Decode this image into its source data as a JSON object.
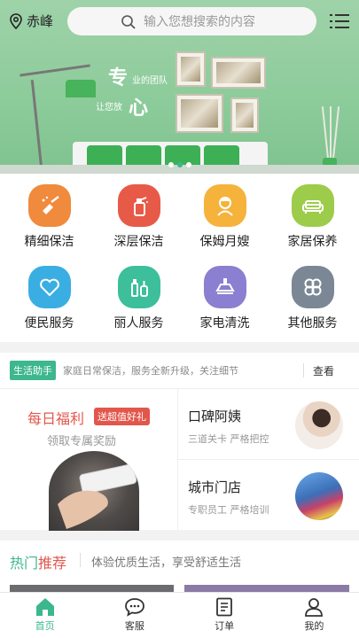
{
  "location": {
    "city": "赤峰"
  },
  "search": {
    "placeholder": "输入您想搜索的内容"
  },
  "banner": {
    "slogan_big_1": "专",
    "slogan_small_1": "业的团队",
    "slogan_small_2": "让您放",
    "slogan_big_2": "心",
    "slides": 3,
    "active_slide": 2
  },
  "services": [
    {
      "label": "精细保洁",
      "icon": "broom-icon",
      "color": "#f08a3c"
    },
    {
      "label": "深层保洁",
      "icon": "spray-bottle-icon",
      "color": "#e85a48"
    },
    {
      "label": "保姆月嫂",
      "icon": "nanny-icon",
      "color": "#f5b33c"
    },
    {
      "label": "家居保养",
      "icon": "sofa-icon",
      "color": "#9ccc4a"
    },
    {
      "label": "便民服务",
      "icon": "heart-icon",
      "color": "#3aaee2"
    },
    {
      "label": "丽人服务",
      "icon": "cosmetics-icon",
      "color": "#3cbf9a"
    },
    {
      "label": "家电清洗",
      "icon": "range-hood-icon",
      "color": "#8a7fd0"
    },
    {
      "label": "其他服务",
      "icon": "clover-icon",
      "color": "#7b8795"
    }
  ],
  "helper": {
    "tag": "生活助手",
    "text": "家庭日常保洁，服务全新升级，关注细节",
    "more": "查看"
  },
  "promo": {
    "daily": {
      "title": "每日福利",
      "badge": "送超值好礼",
      "subtitle": "领取专属奖励"
    },
    "items": [
      {
        "title": "口碑阿姨",
        "subtitle": "三道关卡 严格把控"
      },
      {
        "title": "城市门店",
        "subtitle": "专职员工 严格培训"
      }
    ]
  },
  "hot": {
    "title_green": "热门",
    "title_red": "推荐",
    "subtitle": "体验优质生活，享受舒适生活"
  },
  "tabs": [
    {
      "label": "首页",
      "icon": "home-icon",
      "active": true
    },
    {
      "label": "客服",
      "icon": "chat-icon",
      "active": false
    },
    {
      "label": "订单",
      "icon": "order-icon",
      "active": false
    },
    {
      "label": "我的",
      "icon": "user-icon",
      "active": false
    }
  ],
  "colors": {
    "brand": "#3db78d",
    "accent": "#e2574c"
  }
}
